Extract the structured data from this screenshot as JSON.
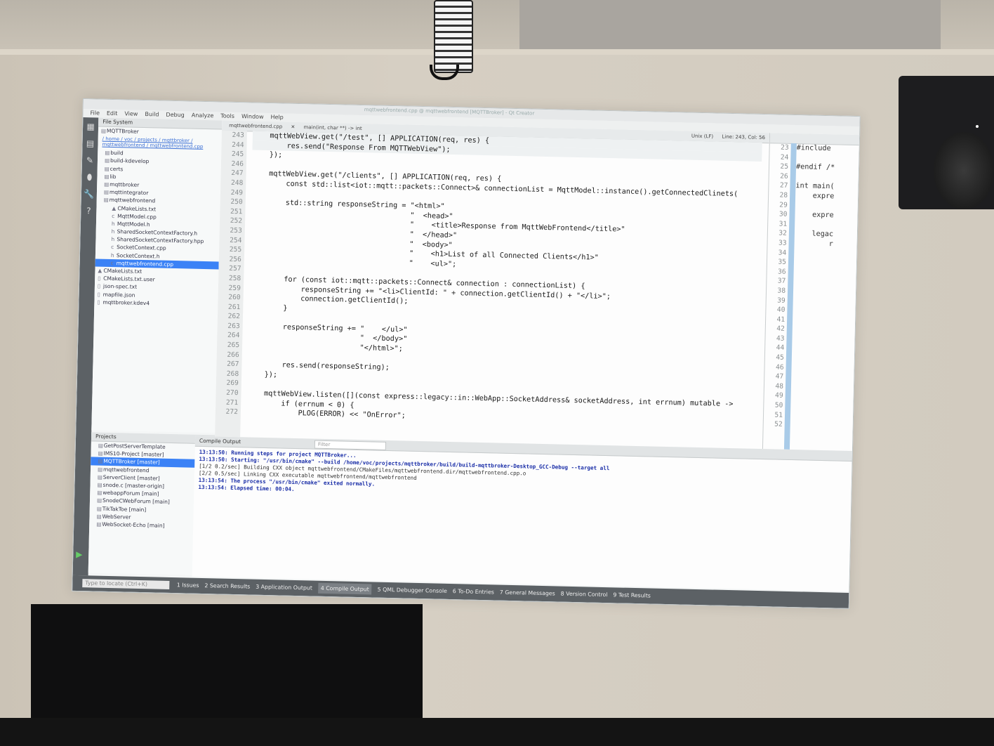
{
  "ide": {
    "menu": [
      "File",
      "Edit",
      "View",
      "Build",
      "Debug",
      "Analyze",
      "Tools",
      "Window",
      "Help"
    ],
    "window_title": "mqttwebfrontend.cpp @ mqttwebfrontend [MQTTBroker] - Qt Creator",
    "file_system": {
      "header": "File System",
      "root": "MQTTBroker",
      "path": "/ home / voc / projects / mqttbroker / mqttwebfrontend / mqttwebfrontend.cpp",
      "items": [
        {
          "name": "build",
          "icon": "folder-icon"
        },
        {
          "name": "build-kdevelop",
          "icon": "folder-icon"
        },
        {
          "name": "certs",
          "icon": "folder-icon"
        },
        {
          "name": "lib",
          "icon": "folder-icon"
        },
        {
          "name": "mqttbroker",
          "icon": "folder-icon"
        },
        {
          "name": "mqttintegrator",
          "icon": "folder-icon"
        },
        {
          "name": "mqttwebfrontend",
          "icon": "folder-icon"
        },
        {
          "name": "CMakeLists.txt",
          "icon": "cmake-icon"
        },
        {
          "name": "MqttModel.cpp",
          "icon": "cpp-file-icon"
        },
        {
          "name": "MqttModel.h",
          "icon": "header-file-icon"
        },
        {
          "name": "SharedSocketContextFactory.h",
          "icon": "header-file-icon"
        },
        {
          "name": "SharedSocketContextFactory.hpp",
          "icon": "header-file-icon"
        },
        {
          "name": "SocketContext.cpp",
          "icon": "cpp-file-icon"
        },
        {
          "name": "SocketContext.h",
          "icon": "header-file-icon"
        },
        {
          "name": "mqttwebfrontend.cpp",
          "icon": "cpp-file-icon"
        },
        {
          "name": "CMakeLists.txt",
          "icon": "cmake-icon"
        },
        {
          "name": "CMakeLists.txt.user",
          "icon": "file-icon"
        },
        {
          "name": "json-spec.txt",
          "icon": "file-icon"
        },
        {
          "name": "mapfile.json",
          "icon": "file-icon"
        },
        {
          "name": "mqttbroker.kdev4",
          "icon": "file-icon"
        }
      ],
      "selected_index": 14
    },
    "projects": {
      "header": "Projects",
      "items": [
        "GetPostServerTemplate",
        "IMS10-Project [master]",
        "MQTTBroker [master]",
        "mqttwebfrontend",
        "ServerClient [master]",
        "snode.c [master-origin]",
        "webappForum [main]",
        "SnodeCWebForum [main]",
        "TikTakToe [main]",
        "WebServer",
        "WebSocket-Echo [main]"
      ],
      "selected_index": 2
    },
    "editor": {
      "file_tab": "mqttwebfrontend.cpp",
      "function": "main(int, char **) -> int",
      "line_ending": "Unix (LF)",
      "position": "Line: 243, Col: 56",
      "line_numbers": [
        "243",
        "244",
        "245",
        "246",
        "247",
        "248",
        "249",
        "250",
        "251",
        "252",
        "253",
        "254",
        "255",
        "256",
        "257",
        "258",
        "259",
        "260",
        "261",
        "262",
        "263",
        "264",
        "265",
        "266",
        "267",
        "268",
        "269",
        "270",
        "271",
        "272"
      ],
      "lines": [
        "    mqttWebView.get(\"/test\", [] APPLICATION(req, res) {",
        "        res.send(\"Response From MQTTWebView\");",
        "    });",
        "",
        "    mqttWebView.get(\"/clients\", [] APPLICATION(req, res) {",
        "        const std::list<iot::mqtt::packets::Connect>& connectionList = MqttModel::instance().getConnectedClinets(",
        "",
        "        std::string responseString = \"<html>\"",
        "                                     \"  <head>\"",
        "                                     \"    <title>Response from MqttWebFrontend</title>\"",
        "                                     \"  </head>\"",
        "                                     \"  <body>\"",
        "                                     \"    <h1>List of all Connected Clients</h1>\"",
        "                                     \"    <ul>\";",
        "",
        "        for (const iot::mqtt::packets::Connect& connection : connectionList) {",
        "            responseString += \"<li>ClientId: \" + connection.getClientId() + \"</li>\";",
        "            connection.getClientId();",
        "        }",
        "",
        "        responseString += \"    </ul>\"",
        "                          \"  </body>\"",
        "                          \"</html>\";",
        "",
        "        res.send(responseString);",
        "    });",
        "",
        "    mqttWebView.listen([](const express::legacy::in::WebApp::SocketAddress& socketAddress, int errnum) mutable ->",
        "        if (errnum < 0) {",
        "            PLOG(ERROR) << \"OnError\";"
      ]
    },
    "split_view": {
      "line_numbers": [
        "23",
        "24",
        "25",
        "26",
        "27",
        "28",
        "29",
        "30",
        "31",
        "32",
        "33",
        "34",
        "35",
        "36",
        "37",
        "38",
        "39",
        "40",
        "41",
        "42",
        "43",
        "44",
        "45",
        "46",
        "47",
        "48",
        "49",
        "50",
        "51",
        "52"
      ],
      "lines": [
        "#include",
        "",
        "#endif /*",
        "",
        "int main(",
        "    expre",
        "",
        "    expre",
        "",
        "    legac",
        "        r",
        "",
        "",
        "",
        "",
        "",
        "",
        "",
        "",
        "",
        "",
        "",
        "",
        "",
        "",
        "",
        "",
        "",
        "",
        ""
      ]
    },
    "output": {
      "header": "Compile Output",
      "filter_placeholder": "Filter",
      "lines": [
        {
          "text": "13:13:50: Running steps for project MQTTBroker...",
          "style": "blue"
        },
        {
          "text": "13:13:50: Starting: \"/usr/bin/cmake\" --build /home/voc/projects/mqttbroker/build/build-mqttbroker-Desktop_GCC-Debug --target all",
          "style": "blue"
        },
        {
          "text": "[1/2 0.2/sec] Building CXX object mqttwebfrontend/CMakeFiles/mqttwebfrontend.dir/mqttwebfrontend.cpp.o",
          "style": "dark"
        },
        {
          "text": "[2/2 0.5/sec] Linking CXX executable mqttwebfrontend/mqttwebfrontend",
          "style": "dark"
        },
        {
          "text": "13:13:54: The process \"/usr/bin/cmake\" exited normally.",
          "style": "blue"
        },
        {
          "text": "13:13:54: Elapsed time: 00:04.",
          "style": "blue"
        }
      ]
    },
    "statusbar": {
      "locate_placeholder": "Type to locate (Ctrl+K)",
      "tabs": [
        "1 Issues",
        "2 Search Results",
        "3 Application Output",
        "4 Compile Output",
        "5 QML Debugger Console",
        "6 To-Do Entries",
        "7 General Messages",
        "8 Version Control",
        "9 Test Results"
      ],
      "active_tab": 3
    }
  }
}
